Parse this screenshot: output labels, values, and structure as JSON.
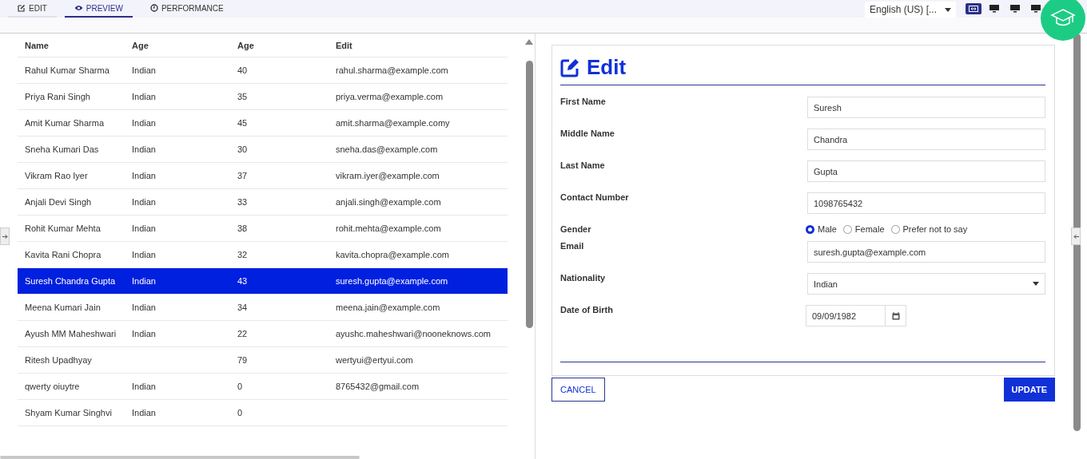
{
  "tabs": [
    {
      "label": "EDIT",
      "kind": "edit",
      "selected": false
    },
    {
      "label": "PREVIEW",
      "kind": "preview",
      "selected": true
    },
    {
      "label": "PERFORMANCE",
      "kind": "performance",
      "selected": false
    }
  ],
  "language": "English (US) [...",
  "view_buttons": [
    {
      "kind": "fit",
      "selected": true
    },
    {
      "kind": "monitor",
      "selected": false
    },
    {
      "kind": "monitor",
      "selected": false
    },
    {
      "kind": "monitor",
      "selected": false
    }
  ],
  "table": {
    "columns": [
      "Name",
      "Age",
      "Age",
      "Edit"
    ],
    "rows": [
      {
        "cells": [
          "Rahul Kumar Sharma",
          "Indian",
          "40",
          "rahul.sharma@example.com"
        ],
        "selected": false
      },
      {
        "cells": [
          "Priya Rani Singh",
          "Indian",
          "35",
          "priya.verma@example.com"
        ],
        "selected": false
      },
      {
        "cells": [
          "Amit Kumar Sharma",
          "Indian",
          "45",
          "amit.sharma@example.comy"
        ],
        "selected": false
      },
      {
        "cells": [
          "Sneha Kumari Das",
          "Indian",
          "30",
          "sneha.das@example.com"
        ],
        "selected": false
      },
      {
        "cells": [
          "Vikram Rao Iyer",
          "Indian",
          "37",
          "vikram.iyer@example.com"
        ],
        "selected": false
      },
      {
        "cells": [
          "Anjali Devi Singh",
          "Indian",
          "33",
          "anjali.singh@example.com"
        ],
        "selected": false
      },
      {
        "cells": [
          "Rohit Kumar Mehta",
          "Indian",
          "38",
          "rohit.mehta@example.com"
        ],
        "selected": false
      },
      {
        "cells": [
          "Kavita Rani Chopra",
          "Indian",
          "32",
          "kavita.chopra@example.com"
        ],
        "selected": false
      },
      {
        "cells": [
          "Suresh Chandra Gupta",
          "Indian",
          "43",
          "suresh.gupta@example.com"
        ],
        "selected": true
      },
      {
        "cells": [
          "Meena Kumari Jain",
          "Indian",
          "34",
          "meena.jain@example.com"
        ],
        "selected": false
      },
      {
        "cells": [
          "Ayush MM Maheshwari",
          "Indian",
          "22",
          "ayushc.maheshwari@nooneknows.com"
        ],
        "selected": false
      },
      {
        "cells": [
          "Ritesh  Upadhyay",
          null,
          "79",
          "wertyui@ertyui.com"
        ],
        "selected": false
      },
      {
        "cells": [
          "qwerty  oiuytre",
          "Indian",
          "0",
          "8765432@gmail.com"
        ],
        "selected": false
      },
      {
        "cells": [
          "Shyam Kumar Singhvi",
          "Indian",
          "0",
          null
        ],
        "selected": false
      }
    ]
  },
  "form": {
    "title": "Edit",
    "fields": [
      {
        "kind": "text",
        "label": "First Name",
        "value": "Suresh"
      },
      {
        "kind": "text",
        "label": "Middle Name",
        "value": "Chandra"
      },
      {
        "kind": "text",
        "label": "Last Name",
        "value": "Gupta"
      },
      {
        "kind": "text",
        "label": "Contact Number",
        "value": "1098765432"
      },
      {
        "kind": "radio",
        "label": "Gender",
        "options": [
          {
            "label": "Male",
            "selected": true
          },
          {
            "label": "Female",
            "selected": false
          },
          {
            "label": "Prefer not to say",
            "selected": false
          }
        ]
      },
      {
        "kind": "text",
        "label": "Email",
        "value": "suresh.gupta@example.com"
      },
      {
        "kind": "select",
        "label": "Nationality",
        "value": "Indian"
      },
      {
        "kind": "date",
        "label": "Date of Birth",
        "value": "09/09/1982"
      }
    ],
    "buttons": [
      {
        "kind": "outline",
        "label": "CANCEL"
      },
      {
        "kind": "primary",
        "label": "UPDATE"
      }
    ]
  }
}
